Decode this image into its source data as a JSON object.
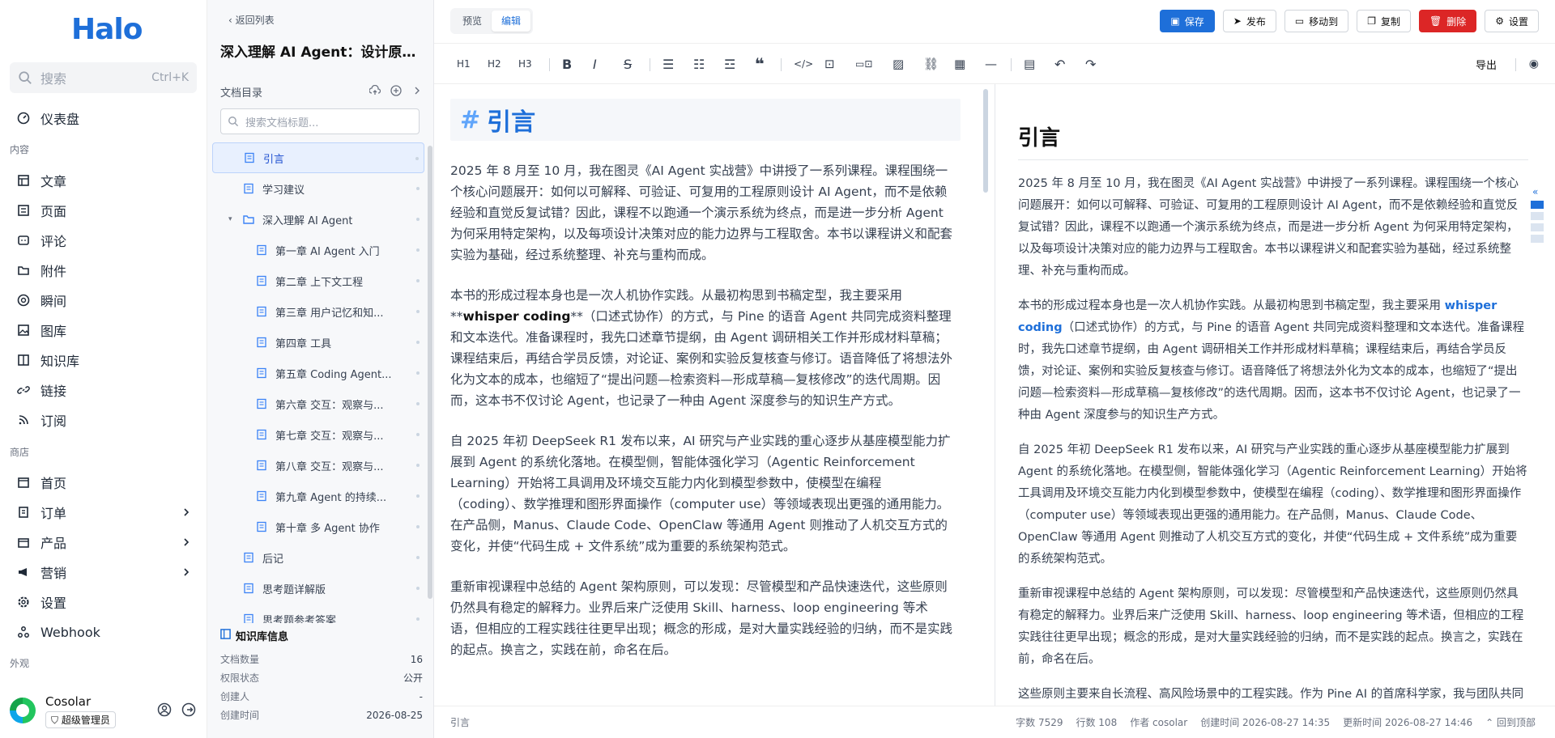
{
  "app": {
    "logo": "Halo",
    "search_placeholder": "搜索",
    "search_shortcut": "Ctrl+K",
    "nav": {
      "dashboard": "仪表盘",
      "group_content": "内容",
      "posts": "文章",
      "pages": "页面",
      "comments": "评论",
      "attachments": "附件",
      "moments": "瞬间",
      "gallery": "图库",
      "knowledge": "知识库",
      "links": "链接",
      "subscriptions": "订阅",
      "group_shop": "商店",
      "home": "首页",
      "orders": "订单",
      "products": "产品",
      "marketing": "营销",
      "settings": "设置",
      "webhook": "Webhook",
      "group_appearance": "外观"
    },
    "user": {
      "name": "Cosolar",
      "role": "超级管理员"
    }
  },
  "doc": {
    "back_label": "返回列表",
    "book_title": "深入理解 AI Agent：设计原…",
    "toc_label": "文档目录",
    "toc_search_placeholder": "搜索文档标题...",
    "toc": [
      {
        "label": "引言",
        "level": 1,
        "active": true
      },
      {
        "label": "学习建议",
        "level": 1
      },
      {
        "label": "深入理解 AI Agent",
        "level": 1,
        "folder": true
      },
      {
        "label": "第一章 AI Agent 入门",
        "level": 2
      },
      {
        "label": "第二章 上下文工程",
        "level": 2
      },
      {
        "label": "第三章 用户记忆和知...",
        "level": 2
      },
      {
        "label": "第四章 工具",
        "level": 2
      },
      {
        "label": "第五章 Coding Agent...",
        "level": 2
      },
      {
        "label": "第六章 交互：观察与...",
        "level": 2
      },
      {
        "label": "第七章 交互：观察与...",
        "level": 2
      },
      {
        "label": "第八章 交互：观察与...",
        "level": 2
      },
      {
        "label": "第九章 Agent 的持续...",
        "level": 2
      },
      {
        "label": "第十章 多 Agent 协作",
        "level": 2
      },
      {
        "label": "后记",
        "level": 1
      },
      {
        "label": "思考题详解版",
        "level": 1
      },
      {
        "label": "思考题参考答案",
        "level": 1
      }
    ],
    "kb_info": {
      "title": "知识库信息",
      "rows": [
        {
          "k": "文档数量",
          "v": "16"
        },
        {
          "k": "权限状态",
          "v": "公开"
        },
        {
          "k": "创建人",
          "v": "-"
        },
        {
          "k": "创建时间",
          "v": "2026-08-25"
        }
      ]
    }
  },
  "toolbar": {
    "preview": "预览",
    "edit": "编辑",
    "save": "保存",
    "publish": "发布",
    "move": "移动到",
    "copy": "复制",
    "delete": "删除",
    "settings": "设置",
    "h1": "H1",
    "h2": "H2",
    "h3": "H3",
    "export": "导出"
  },
  "editor": {
    "h1": "引言",
    "p1": "2025 年 8 月至 10 月，我在图灵《AI Agent 实战营》中讲授了一系列课程。课程围绕一个核心问题展开：如何以可解释、可验证、可复用的工程原则设计 AI Agent，而不是依赖经验和直觉反复试错？因此，课程不以跑通一个演示系统为终点，而是进一步分析 Agent 为何采用特定架构，以及每项设计决策对应的能力边界与工程取舍。本书以课程讲义和配套实验为基础，经过系统整理、补充与重构而成。",
    "p2a": "本书的形成过程本身也是一次人机协作实践。从最初构思到书稿定型，我主要采用 **",
    "p2b": "whisper coding",
    "p2c": "**（口述式协作）的方式，与 Pine 的语音 Agent 共同完成资料整理和文本迭代。准备课程时，我先口述章节提纲，由 Agent 调研相关工作并形成材料草稿；课程结束后，再结合学员反馈，对论证、案例和实验反复核查与修订。语音降低了将想法外化为文本的成本，也缩短了“提出问题—检索资料—形成草稿—复核修改”的迭代周期。因而，这本书不仅讨论 Agent，也记录了一种由 Agent 深度参与的知识生产方式。",
    "p3": "自 2025 年初 DeepSeek R1 发布以来，AI 研究与产业实践的重心逐步从基座模型能力扩展到 Agent 的系统化落地。在模型侧，智能体强化学习（Agentic Reinforcement Learning）开始将工具调用及环境交互能力内化到模型参数中，使模型在编程（coding）、数学推理和图形界面操作（computer use）等领域表现出更强的通用能力。在产品侧，Manus、Claude Code、OpenClaw 等通用 Agent 则推动了人机交互方式的变化，并使“代码生成 + 文件系统”成为重要的系统架构范式。",
    "p4": "重新审视课程中总结的 Agent 架构原则，可以发现：尽管模型和产品快速迭代，这些原则仍然具有稳定的解释力。业界后来广泛使用 Skill、harness、loop engineering 等术语，但相应的工程实践往往更早出现；概念的形成，是对大量实践经验的归纳，而不是实践的起点。换言之，实践在前，命名在后。"
  },
  "preview": {
    "h1": "引言",
    "p1": "2025 年 8 月至 10 月，我在图灵《AI Agent 实战营》中讲授了一系列课程。课程围绕一个核心问题展开：如何以可解释、可验证、可复用的工程原则设计 AI Agent，而不是依赖经验和直觉反复试错？因此，课程不以跑通一个演示系统为终点，而是进一步分析 Agent 为何采用特定架构，以及每项设计决策对应的能力边界与工程取舍。本书以课程讲义和配套实验为基础，经过系统整理、补充与重构而成。",
    "p2a": "本书的形成过程本身也是一次人机协作实践。从最初构思到书稿定型，我主要采用 ",
    "p2b": "whisper coding",
    "p2c": "（口述式协作）的方式，与 Pine 的语音 Agent 共同完成资料整理和文本迭代。准备课程时，我先口述章节提纲，由 Agent 调研相关工作并形成材料草稿；课程结束后，再结合学员反馈，对论证、案例和实验反复核查与修订。语音降低了将想法外化为文本的成本，也缩短了“提出问题—检索资料—形成草稿—复核修改”的迭代周期。因而，这本书不仅讨论 Agent，也记录了一种由 Agent 深度参与的知识生产方式。",
    "p3": "自 2025 年初 DeepSeek R1 发布以来，AI 研究与产业实践的重心逐步从基座模型能力扩展到 Agent 的系统化落地。在模型侧，智能体强化学习（Agentic Reinforcement Learning）开始将工具调用及环境交互能力内化到模型参数中，使模型在编程（coding）、数学推理和图形界面操作（computer use）等领域表现出更强的通用能力。在产品侧，Manus、Claude Code、OpenClaw 等通用 Agent 则推动了人机交互方式的变化，并使“代码生成 + 文件系统”成为重要的系统架构范式。",
    "p4": "重新审视课程中总结的 Agent 架构原则，可以发现：尽管模型和产品快速迭代，这些原则仍然具有稳定的解释力。业界后来广泛使用 Skill、harness、loop engineering 等术语，但相应的工程实践往往更早出现；概念的形成，是对大量实践经验的归纳，而不是实践的起点。换言之，实践在前，命名在后。",
    "p5": "这些原则主要来自长流程、高风险场景中的工程实践。作为 Pine AI 的首席科学家，我与团队共同研发了 Pine，使 Agent 能够代表用户与真人沟通，并处理账单协商、退款投诉和订阅取消等"
  },
  "status": {
    "left": "引言",
    "chars": "字数 7529",
    "lines": "行数 108",
    "author": "作者 cosolar",
    "created": "创建时间 2026-08-27 14:35",
    "updated": "更新时间 2026-08-27 14:46",
    "back_top": "回到顶部"
  }
}
